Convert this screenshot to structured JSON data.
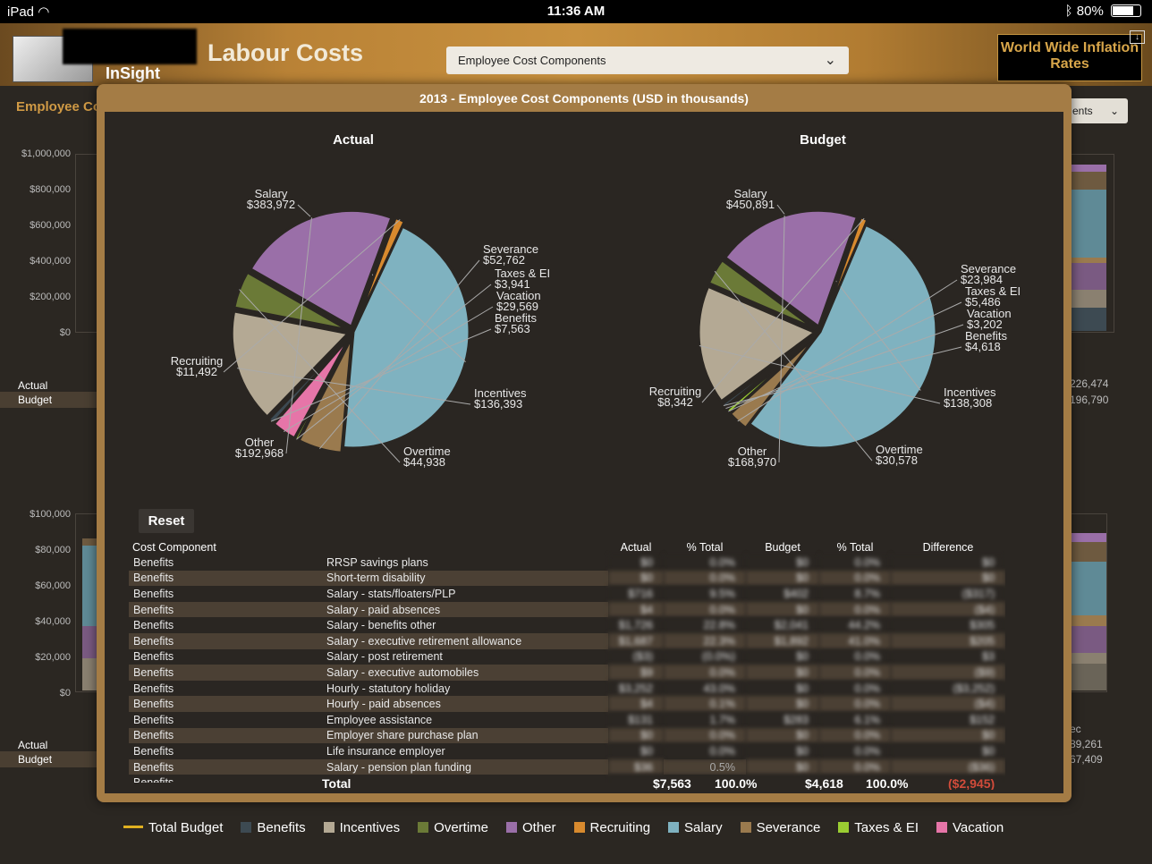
{
  "status": {
    "device": "iPad",
    "time": "11:36 AM",
    "battery": "80%",
    "battery_level": 0.8
  },
  "header": {
    "app_name": "InSight",
    "title": "Labour Costs",
    "dropdown_value": "Employee Cost Components",
    "world_wide_btn": "World Wide Inflation Rates"
  },
  "background": {
    "section_title": "Employee Co",
    "dropdown_partial": "ents",
    "y_axis_top": [
      "$1,000,000",
      "$800,000",
      "$600,000",
      "$400,000",
      "$200,000",
      "$0"
    ],
    "y_axis_bottom": [
      "$100,000",
      "$80,000",
      "$60,000",
      "$40,000",
      "$20,000",
      "$0"
    ],
    "row_labels": {
      "actual": "Actual",
      "budget": "Budget"
    },
    "right_values_top": {
      "actual": "226,474",
      "budget": "196,790"
    },
    "right_values_bottom": {
      "month": "ec",
      "actual": "89,261",
      "budget": "67,409"
    }
  },
  "modal": {
    "title": "2013 -  Employee Cost Components (USD in thousands)",
    "reset_label": "Reset"
  },
  "chart_data": [
    {
      "type": "pie",
      "title": "Actual",
      "slices": [
        {
          "label": "Salary",
          "value": 383972,
          "display": "$383,972",
          "color": "#7fb2c0"
        },
        {
          "label": "Severance",
          "value": 52762,
          "display": "$52,762",
          "color": "#9a7a4e"
        },
        {
          "label": "Taxes & EI",
          "value": 3941,
          "display": "$3,941",
          "color": "#9acd32"
        },
        {
          "label": "Vacation",
          "value": 29569,
          "display": "$29,569",
          "color": "#e675a8"
        },
        {
          "label": "Benefits",
          "value": 7563,
          "display": "$7,563",
          "color": "#3d4a52"
        },
        {
          "label": "Incentives",
          "value": 136393,
          "display": "$136,393",
          "color": "#b4a994"
        },
        {
          "label": "Overtime",
          "value": 44938,
          "display": "$44,938",
          "color": "#6b7a37"
        },
        {
          "label": "Other",
          "value": 192968,
          "display": "$192,968",
          "color": "#9a6fa8"
        },
        {
          "label": "Recruiting",
          "value": 11492,
          "display": "$11,492",
          "color": "#d88a2e"
        }
      ]
    },
    {
      "type": "pie",
      "title": "Budget",
      "slices": [
        {
          "label": "Salary",
          "value": 450891,
          "display": "$450,891",
          "color": "#7fb2c0"
        },
        {
          "label": "Severance",
          "value": 23984,
          "display": "$23,984",
          "color": "#9a7a4e"
        },
        {
          "label": "Taxes & EI",
          "value": 5486,
          "display": "$5,486",
          "color": "#9acd32"
        },
        {
          "label": "Vacation",
          "value": 3202,
          "display": "$3,202",
          "color": "#e675a8"
        },
        {
          "label": "Benefits",
          "value": 4618,
          "display": "$4,618",
          "color": "#3d4a52"
        },
        {
          "label": "Incentives",
          "value": 138308,
          "display": "$138,308",
          "color": "#b4a994"
        },
        {
          "label": "Overtime",
          "value": 30578,
          "display": "$30,578",
          "color": "#6b7a37"
        },
        {
          "label": "Other",
          "value": 168970,
          "display": "$168,970",
          "color": "#9a6fa8"
        },
        {
          "label": "Recruiting",
          "value": 8342,
          "display": "$8,342",
          "color": "#d88a2e"
        }
      ]
    }
  ],
  "table": {
    "headers": [
      "Cost Component",
      "",
      "Actual",
      "% Total",
      "Budget",
      "% Total",
      "Difference"
    ],
    "rows": [
      [
        "Benefits",
        "RRSP savings plans",
        "$0",
        "0.0%",
        "$0",
        "0.0%",
        "$0"
      ],
      [
        "Benefits",
        "Short-term disability",
        "$0",
        "0.0%",
        "$0",
        "0.0%",
        "$0"
      ],
      [
        "Benefits",
        "Salary - stats/floaters/PLP",
        "$716",
        "9.5%",
        "$402",
        "8.7%",
        "($317)"
      ],
      [
        "Benefits",
        "Salary - paid absences",
        "$4",
        "0.0%",
        "$0",
        "0.0%",
        "($4)"
      ],
      [
        "Benefits",
        "Salary - benefits other",
        "$1,726",
        "22.8%",
        "$2,041",
        "44.2%",
        "$305"
      ],
      [
        "Benefits",
        "Salary - executive retirement allowance",
        "$1,687",
        "22.3%",
        "$1,892",
        "41.0%",
        "$205"
      ],
      [
        "Benefits",
        "Salary - post retirement",
        "($3)",
        "(0.0%)",
        "$0",
        "0.0%",
        "$3"
      ],
      [
        "Benefits",
        "Salary - executive automobiles",
        "$9",
        "0.0%",
        "$0",
        "0.0%",
        "($9)"
      ],
      [
        "Benefits",
        "Hourly - statutory holiday",
        "$3,252",
        "43.0%",
        "$0",
        "0.0%",
        "($3,252)"
      ],
      [
        "Benefits",
        "Hourly - paid absences",
        "$4",
        "0.1%",
        "$0",
        "0.0%",
        "($4)"
      ],
      [
        "Benefits",
        "Employee assistance",
        "$131",
        "1.7%",
        "$283",
        "6.1%",
        "$152"
      ],
      [
        "Benefits",
        "Employer share purchase plan",
        "$0",
        "0.0%",
        "$0",
        "0.0%",
        "$0"
      ],
      [
        "Benefits",
        "Life insurance employer",
        "$0",
        "0.0%",
        "$0",
        "0.0%",
        "$0"
      ],
      [
        "Benefits",
        "Salary - pension plan funding",
        "$36",
        "0.5%",
        "$0",
        "0.0%",
        "($36)"
      ],
      [
        "Benefits",
        "",
        "",
        "",
        "",
        "",
        ""
      ]
    ],
    "blurred_cols": [
      2,
      3,
      4,
      5,
      6
    ],
    "visible_cells": [
      [
        13,
        3
      ]
    ],
    "total": {
      "label": "Total",
      "actual": "$7,563",
      "pct_actual": "100.0%",
      "budget": "$4,618",
      "pct_budget": "100.0%",
      "difference": "($2,945)"
    }
  },
  "legend": [
    {
      "label": "Total Budget",
      "color": "#e0b020",
      "kind": "line"
    },
    {
      "label": "Benefits",
      "color": "#3d4a52",
      "kind": "box"
    },
    {
      "label": "Incentives",
      "color": "#b4a994",
      "kind": "box"
    },
    {
      "label": "Overtime",
      "color": "#6b7a37",
      "kind": "box"
    },
    {
      "label": "Other",
      "color": "#9a6fa8",
      "kind": "box"
    },
    {
      "label": "Recruiting",
      "color": "#d88a2e",
      "kind": "box"
    },
    {
      "label": "Salary",
      "color": "#7fb2c0",
      "kind": "box"
    },
    {
      "label": "Severance",
      "color": "#9a7a4e",
      "kind": "box"
    },
    {
      "label": "Taxes & EI",
      "color": "#9acd32",
      "kind": "box"
    },
    {
      "label": "Vacation",
      "color": "#e675a8",
      "kind": "box"
    }
  ]
}
